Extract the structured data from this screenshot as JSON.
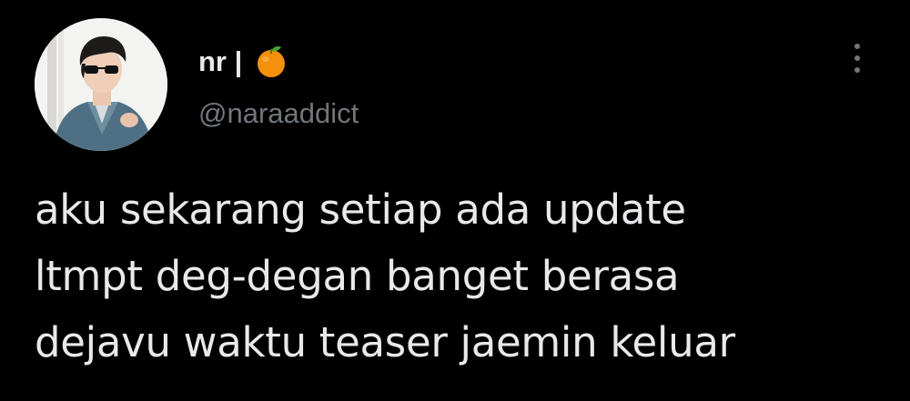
{
  "tweet": {
    "author": {
      "display_name": "nr |",
      "name_emoji_icon": "tangerine-icon",
      "username": "@naraaddict",
      "avatar_icon": "profile-photo"
    },
    "more_options_icon": "vertical-ellipsis-icon",
    "text_lines": [
      "aku sekarang setiap ada update",
      "ltmpt deg-degan banget berasa",
      "dejavu waktu teaser jaemin keluar"
    ]
  },
  "colors": {
    "background": "#000000",
    "primary_text": "#e7e9ea",
    "secondary_text": "#71767b",
    "emoji_orange": "#f5900c"
  }
}
